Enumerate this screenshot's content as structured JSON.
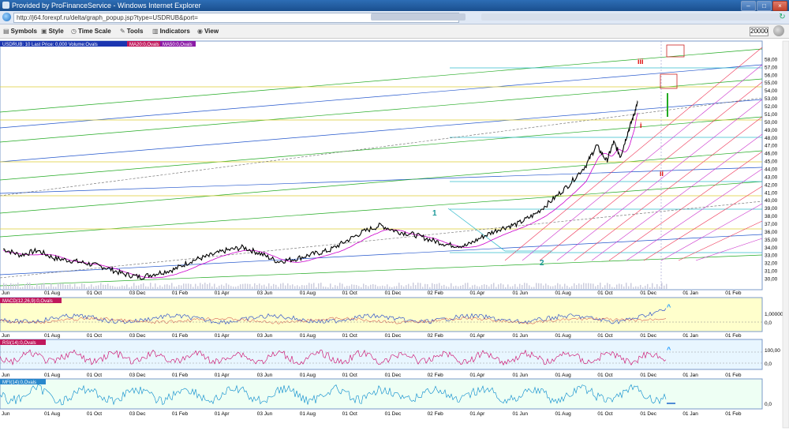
{
  "window": {
    "title": "Provided by ProFinanceService - Windows Internet Explorer",
    "url": "http://j64.forexpf.ru/delta/graph_popup.jsp?type=USDRUB&port="
  },
  "toolbar": {
    "items": [
      {
        "label": "Symbols",
        "icon": "list-icon"
      },
      {
        "label": "Style",
        "icon": "brush-icon"
      },
      {
        "label": "Time Scale",
        "icon": "clock-icon"
      },
      {
        "label": "Tools",
        "icon": "tools-icon"
      },
      {
        "label": "Indicators",
        "icon": "chart-icon"
      },
      {
        "label": "View",
        "icon": "eye-icon"
      }
    ],
    "bars_count": "20000"
  },
  "colors": {
    "price": "#000000",
    "ma_magenta": "#cc00cc",
    "macd": "#3355cc",
    "rsi": "#cc0066",
    "mfi": "#0077cc",
    "panel_bg": "#ffffcc",
    "rsi_bg": "#e8f6ff",
    "mfi_bg": "#eefff4",
    "wave_red": "#dd0000",
    "wave_teal": "#1a9999"
  },
  "panels": {
    "main": {
      "legend": "USDRUB: 10 Last Price: 0,000 Volume:Ovals",
      "ma1": "MA20:0,Ovals",
      "ma2": "MA50:0,Ovals"
    },
    "macd": {
      "legend": "MACD(12,26,9):0,Ovals",
      "ticks": [
        "1,00000",
        "0,0"
      ]
    },
    "rsi": {
      "legend": "RSI(14):0,Ovals",
      "ticks": [
        "100,00",
        "0,0"
      ]
    },
    "mfi": {
      "legend": "MFI(14):0,Ovals",
      "ticks": [
        "0,0"
      ]
    }
  },
  "chart_data": {
    "type": "line",
    "title": "",
    "price_axis": [
      "58,00",
      "57,00",
      "56,00",
      "55,00",
      "54,00",
      "53,00",
      "52,00",
      "51,00",
      "50,00",
      "49,00",
      "48,00",
      "47,00",
      "46,00",
      "45,00",
      "44,00",
      "43,00",
      "42,00",
      "41,00",
      "40,00",
      "39,00",
      "38,00",
      "37,00",
      "36,00",
      "35,00",
      "34,00",
      "33,00",
      "32,00",
      "31,00",
      "30,00"
    ],
    "ylim": [
      29.5,
      59
    ],
    "time_labels": [
      "Jun",
      "01 Aug",
      "01 Oct",
      "03 Dec",
      "01 Feb",
      "01 Apr",
      "03 Jun",
      "01 Aug",
      "01 Oct",
      "01 Dec",
      "02 Feb",
      "01 Apr",
      "01 Jun",
      "01 Aug",
      "01 Oct",
      "01 Dec",
      "01 Jan",
      "01 Feb"
    ],
    "waves": [
      {
        "label": "1",
        "color": "teal"
      },
      {
        "label": "2",
        "color": "teal"
      },
      {
        "label": "i",
        "color": "red"
      },
      {
        "label": "ii",
        "color": "red"
      },
      {
        "label": "iii",
        "color": "red"
      }
    ],
    "price_series": [
      {
        "t": 0,
        "v": 33.8
      },
      {
        "t": 0.5,
        "v": 33.0
      },
      {
        "t": 1,
        "v": 33.6
      },
      {
        "t": 1.5,
        "v": 32.6
      },
      {
        "t": 2,
        "v": 32.3
      },
      {
        "t": 2.5,
        "v": 31.9
      },
      {
        "t": 3,
        "v": 31.4
      },
      {
        "t": 3.5,
        "v": 30.6
      },
      {
        "t": 4,
        "v": 30.2
      },
      {
        "t": 4.5,
        "v": 30.7
      },
      {
        "t": 5,
        "v": 31.2
      },
      {
        "t": 5.5,
        "v": 32.3
      },
      {
        "t": 6,
        "v": 32.9
      },
      {
        "t": 6.5,
        "v": 33.6
      },
      {
        "t": 7,
        "v": 34.0
      },
      {
        "t": 7.5,
        "v": 33.2
      },
      {
        "t": 8,
        "v": 32.2
      },
      {
        "t": 8.5,
        "v": 32.5
      },
      {
        "t": 9,
        "v": 33.1
      },
      {
        "t": 9.5,
        "v": 33.6
      },
      {
        "t": 10,
        "v": 34.8
      },
      {
        "t": 10.5,
        "v": 36.0
      },
      {
        "t": 11,
        "v": 36.8
      },
      {
        "t": 11.5,
        "v": 36.0
      },
      {
        "t": 12,
        "v": 35.6
      },
      {
        "t": 12.5,
        "v": 34.9
      },
      {
        "t": 13,
        "v": 34.3
      },
      {
        "t": 13.5,
        "v": 34.2
      },
      {
        "t": 14,
        "v": 35.4
      },
      {
        "t": 14.5,
        "v": 36.4
      },
      {
        "t": 15,
        "v": 37.0
      },
      {
        "t": 15.5,
        "v": 38.2
      },
      {
        "t": 16,
        "v": 40.0
      },
      {
        "t": 16.5,
        "v": 42.0
      },
      {
        "t": 17,
        "v": 44.5
      },
      {
        "t": 17.3,
        "v": 47.0
      },
      {
        "t": 17.6,
        "v": 45.0
      },
      {
        "t": 17.8,
        "v": 47.4
      },
      {
        "t": 18.0,
        "v": 45.6
      },
      {
        "t": 18.2,
        "v": 48.5
      },
      {
        "t": 18.4,
        "v": 51.0
      },
      {
        "t": 18.5,
        "v": 52.5
      }
    ]
  }
}
